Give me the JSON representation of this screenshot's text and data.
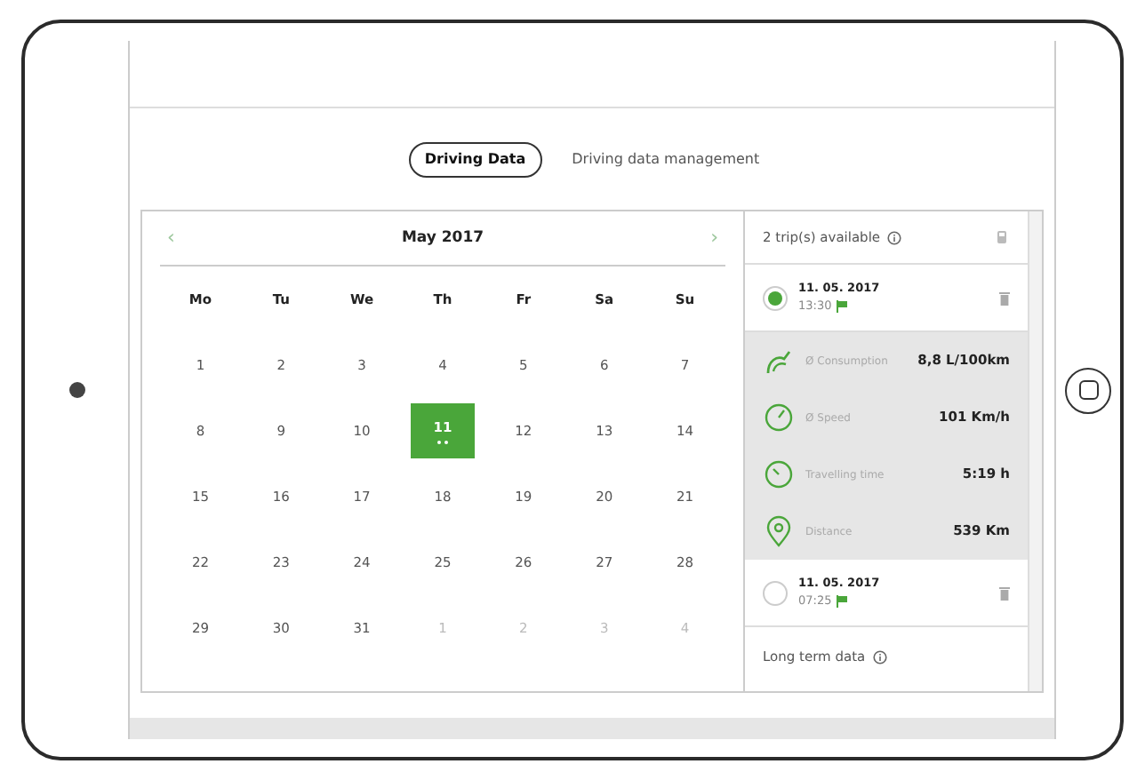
{
  "tabs": [
    {
      "label": "Driving Data",
      "selected": true
    },
    {
      "label": "Driving data management",
      "selected": false
    }
  ],
  "calendar": {
    "prev": "‹",
    "next": "›",
    "month": "May 2017",
    "weekdays": [
      "Mo",
      "Tu",
      "We",
      "Th",
      "Fr",
      "Sa",
      "Su"
    ],
    "days": [
      {
        "label": "1",
        "muted": false,
        "selected": false,
        "has_trips": false
      },
      {
        "label": "2",
        "muted": false,
        "selected": false,
        "has_trips": false
      },
      {
        "label": "3",
        "muted": false,
        "selected": false,
        "has_trips": false
      },
      {
        "label": "4",
        "muted": false,
        "selected": false,
        "has_trips": false
      },
      {
        "label": "5",
        "muted": false,
        "selected": false,
        "has_trips": false
      },
      {
        "label": "6",
        "muted": false,
        "selected": false,
        "has_trips": false
      },
      {
        "label": "7",
        "muted": false,
        "selected": false,
        "has_trips": false
      },
      {
        "label": "8",
        "muted": false,
        "selected": false,
        "has_trips": false
      },
      {
        "label": "9",
        "muted": false,
        "selected": false,
        "has_trips": false
      },
      {
        "label": "10",
        "muted": false,
        "selected": false,
        "has_trips": false
      },
      {
        "label": "11",
        "muted": false,
        "selected": true,
        "has_trips": true
      },
      {
        "label": "12",
        "muted": false,
        "selected": false,
        "has_trips": false
      },
      {
        "label": "13",
        "muted": false,
        "selected": false,
        "has_trips": false
      },
      {
        "label": "14",
        "muted": false,
        "selected": false,
        "has_trips": false
      },
      {
        "label": "15",
        "muted": false,
        "selected": false,
        "has_trips": false
      },
      {
        "label": "16",
        "muted": false,
        "selected": false,
        "has_trips": false
      },
      {
        "label": "17",
        "muted": false,
        "selected": false,
        "has_trips": false
      },
      {
        "label": "18",
        "muted": false,
        "selected": false,
        "has_trips": false
      },
      {
        "label": "19",
        "muted": false,
        "selected": false,
        "has_trips": false
      },
      {
        "label": "20",
        "muted": false,
        "selected": false,
        "has_trips": false
      },
      {
        "label": "21",
        "muted": false,
        "selected": false,
        "has_trips": false
      },
      {
        "label": "22",
        "muted": false,
        "selected": false,
        "has_trips": false
      },
      {
        "label": "23",
        "muted": false,
        "selected": false,
        "has_trips": false
      },
      {
        "label": "24",
        "muted": false,
        "selected": false,
        "has_trips": false
      },
      {
        "label": "25",
        "muted": false,
        "selected": false,
        "has_trips": false
      },
      {
        "label": "26",
        "muted": false,
        "selected": false,
        "has_trips": false
      },
      {
        "label": "27",
        "muted": false,
        "selected": false,
        "has_trips": false
      },
      {
        "label": "28",
        "muted": false,
        "selected": false,
        "has_trips": false
      },
      {
        "label": "29",
        "muted": false,
        "selected": false,
        "has_trips": false
      },
      {
        "label": "30",
        "muted": false,
        "selected": false,
        "has_trips": false
      },
      {
        "label": "31",
        "muted": false,
        "selected": false,
        "has_trips": false
      },
      {
        "label": "1",
        "muted": true,
        "selected": false,
        "has_trips": false
      },
      {
        "label": "2",
        "muted": true,
        "selected": false,
        "has_trips": false
      },
      {
        "label": "3",
        "muted": true,
        "selected": false,
        "has_trips": false
      },
      {
        "label": "4",
        "muted": true,
        "selected": false,
        "has_trips": false
      }
    ]
  },
  "trips_panel": {
    "header": "2 trip(s) available",
    "trips": [
      {
        "date": "11. 05. 2017",
        "time": "13:30",
        "selected": true,
        "stats": [
          {
            "kind": "consumption",
            "label": "Ø Consumption",
            "value": "8,8 L/100km"
          },
          {
            "kind": "speed",
            "label": "Ø Speed",
            "value": "101 Km/h"
          },
          {
            "kind": "time",
            "label": "Travelling time",
            "value": "5:19 h"
          },
          {
            "kind": "distance",
            "label": "Distance",
            "value": "539 Km"
          }
        ]
      },
      {
        "date": "11. 05. 2017",
        "time": "07:25",
        "selected": false
      }
    ],
    "long_term": "Long term data"
  }
}
